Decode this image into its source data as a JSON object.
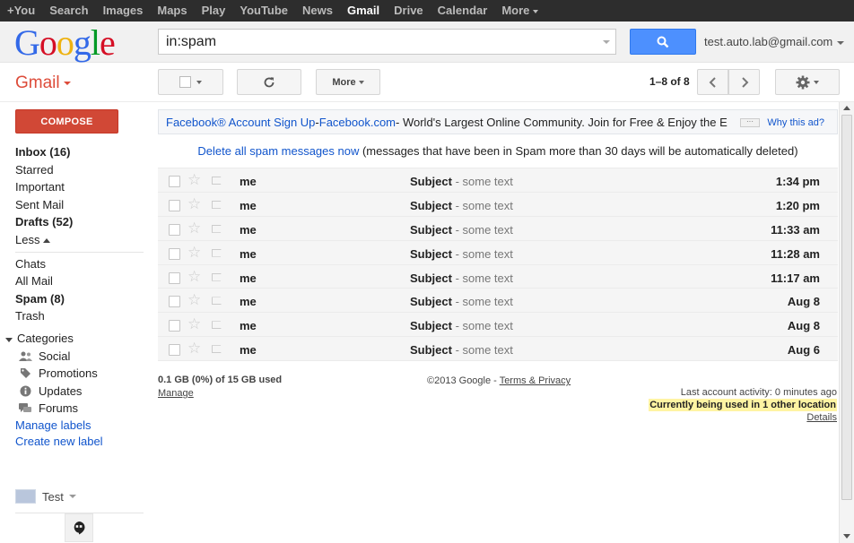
{
  "topbar": {
    "items": [
      "+You",
      "Search",
      "Images",
      "Maps",
      "Play",
      "YouTube",
      "News",
      "Gmail",
      "Drive",
      "Calendar",
      "More"
    ],
    "active": "Gmail"
  },
  "header": {
    "logo": "Google",
    "search_value": "in:spam",
    "account": "test.auto.lab@gmail.com"
  },
  "toolbar": {
    "gmail_label": "Gmail",
    "more_label": "More",
    "pagination": "1–8 of 8"
  },
  "sidebar": {
    "compose": "COMPOSE",
    "items": [
      {
        "label": "Inbox (16)",
        "bold": true
      },
      {
        "label": "Starred",
        "bold": false
      },
      {
        "label": "Important",
        "bold": false
      },
      {
        "label": "Sent Mail",
        "bold": false
      },
      {
        "label": "Drafts (52)",
        "bold": true
      }
    ],
    "less": "Less",
    "items2": [
      {
        "label": "Chats",
        "bold": false
      },
      {
        "label": "All Mail",
        "bold": false
      },
      {
        "label": "Spam (8)",
        "bold": true
      },
      {
        "label": "Trash",
        "bold": false
      }
    ],
    "categories_label": "Categories",
    "categories": [
      "Social",
      "Promotions",
      "Updates",
      "Forums"
    ],
    "manage_labels": "Manage labels",
    "create_label": "Create new label",
    "user": "Test"
  },
  "ad": {
    "link1": "Facebook® Account Sign Up",
    "sep": " - ",
    "link2": "Facebook.com",
    "text": " - World's Largest Online Community. Join for Free & Enjoy the E",
    "more": "···",
    "why": "Why this ad?"
  },
  "spam_notice": {
    "link": "Delete all spam messages now",
    "text": " (messages that have been in Spam more than 30 days will be automatically deleted)"
  },
  "messages": [
    {
      "from": "me",
      "subject": "Subject",
      "snippet": " - some text",
      "date": "1:34 pm"
    },
    {
      "from": "me",
      "subject": "Subject",
      "snippet": " - some text",
      "date": "1:20 pm"
    },
    {
      "from": "me",
      "subject": "Subject",
      "snippet": " - some text",
      "date": "11:33 am"
    },
    {
      "from": "me",
      "subject": "Subject",
      "snippet": " - some text",
      "date": "11:28 am"
    },
    {
      "from": "me",
      "subject": "Subject",
      "snippet": " - some text",
      "date": "11:17 am"
    },
    {
      "from": "me",
      "subject": "Subject",
      "snippet": " - some text",
      "date": "Aug 8"
    },
    {
      "from": "me",
      "subject": "Subject",
      "snippet": " - some text",
      "date": "Aug 8"
    },
    {
      "from": "me",
      "subject": "Subject",
      "snippet": " - some text",
      "date": "Aug 6"
    }
  ],
  "footer": {
    "storage": "0.1 GB (0%) of 15 GB used",
    "manage": "Manage",
    "copyright": "©2013 Google - ",
    "terms": "Terms & Privacy",
    "activity": "Last account activity: 0 minutes ago",
    "other_location": "Currently being used in 1 other location",
    "details": "Details"
  },
  "colors": {
    "topbar_bg": "#2d2d2d",
    "compose_red": "#d14836",
    "search_blue": "#4d90fe",
    "link_blue": "#1155cc",
    "highlight_yellow": "#fff4a3"
  }
}
